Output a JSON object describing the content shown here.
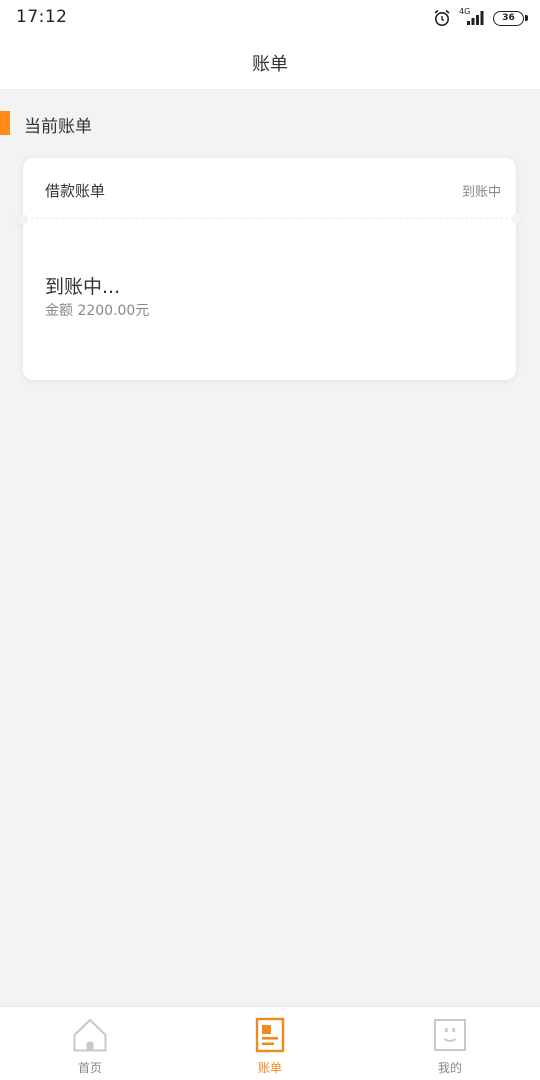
{
  "status_bar": {
    "time": "17:12",
    "network_type": "4G",
    "battery": "36",
    "icons": [
      "alarm-icon",
      "signal-icon",
      "battery-icon"
    ]
  },
  "header": {
    "title": "账单"
  },
  "section": {
    "title": "当前账单"
  },
  "bill_card": {
    "type": "借款账单",
    "status_small": "到账中",
    "status_big": "到账中...",
    "amount": "金额 2200.00元"
  },
  "bottom_nav": {
    "items": [
      {
        "label": "首页",
        "icon": "home-icon",
        "active": false
      },
      {
        "label": "账单",
        "icon": "bill-icon",
        "active": true
      },
      {
        "label": "我的",
        "icon": "profile-icon",
        "active": false
      }
    ]
  },
  "colors": {
    "accent": "#ff8a1c",
    "background": "#f3f3f3",
    "inactive": "#c8c8c8"
  }
}
